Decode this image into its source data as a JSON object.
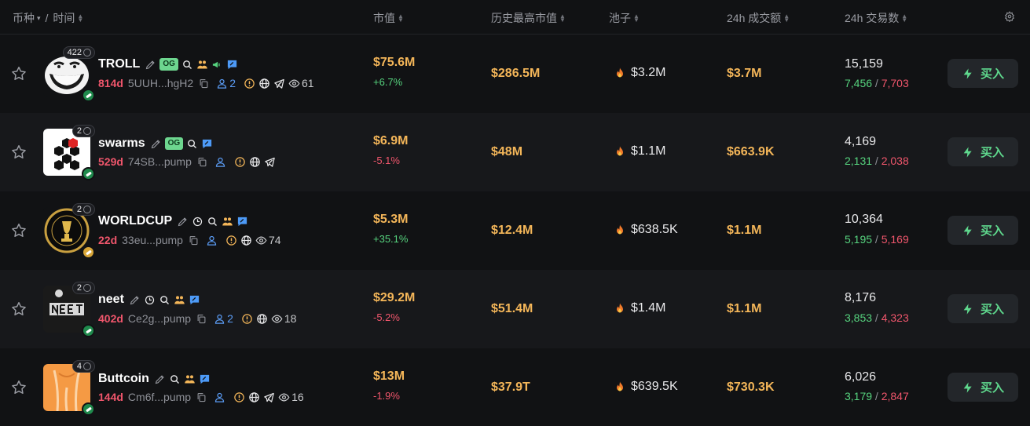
{
  "header": {
    "token_label": "币种",
    "time_label": "时间",
    "market_cap": "市值",
    "ath_market_cap": "历史最高市值",
    "pool": "池子",
    "volume_24h": "24h 成交额",
    "tx_24h": "24h 交易数",
    "settings_icon": "gear-icon"
  },
  "buy_label": "买入",
  "colors": {
    "positive": "#56d37e",
    "negative": "#f0566c",
    "value": "#f4b659",
    "accent": "#5b9cf5"
  },
  "tokens": [
    {
      "name": "TROLL",
      "count": "422",
      "age": "814d",
      "address": "5UUH...hgH2",
      "holders": "2",
      "views": "61",
      "market_cap": "$75.6M",
      "change": "+6.7%",
      "ath": "$286.5M",
      "pool": "$3.2M",
      "volume": "$3.7M",
      "tx": "15,159",
      "buys": "7,456",
      "sells": "7,703"
    },
    {
      "name": "swarms",
      "count": "2",
      "age": "529d",
      "address": "74SB...pump",
      "holders": "",
      "views": "",
      "market_cap": "$6.9M",
      "change": "-5.1%",
      "ath": "$48M",
      "pool": "$1.1M",
      "volume": "$663.9K",
      "tx": "4,169",
      "buys": "2,131",
      "sells": "2,038"
    },
    {
      "name": "WORLDCUP",
      "count": "2",
      "age": "22d",
      "address": "33eu...pump",
      "holders": "",
      "views": "74",
      "market_cap": "$5.3M",
      "change": "+35.1%",
      "ath": "$12.4M",
      "pool": "$638.5K",
      "volume": "$1.1M",
      "tx": "10,364",
      "buys": "5,195",
      "sells": "5,169"
    },
    {
      "name": "neet",
      "count": "2",
      "age": "402d",
      "address": "Ce2g...pump",
      "holders": "2",
      "views": "18",
      "market_cap": "$29.2M",
      "change": "-5.2%",
      "ath": "$51.4M",
      "pool": "$1.4M",
      "volume": "$1.1M",
      "tx": "8,176",
      "buys": "3,853",
      "sells": "4,323"
    },
    {
      "name": "Buttcoin",
      "count": "4",
      "age": "144d",
      "address": "Cm6f...pump",
      "holders": "",
      "views": "16",
      "market_cap": "$13M",
      "change": "-1.9%",
      "ath": "$37.9T",
      "pool": "$639.5K",
      "volume": "$730.3K",
      "tx": "6,026",
      "buys": "3,179",
      "sells": "2,847"
    }
  ],
  "og_label": "OG"
}
